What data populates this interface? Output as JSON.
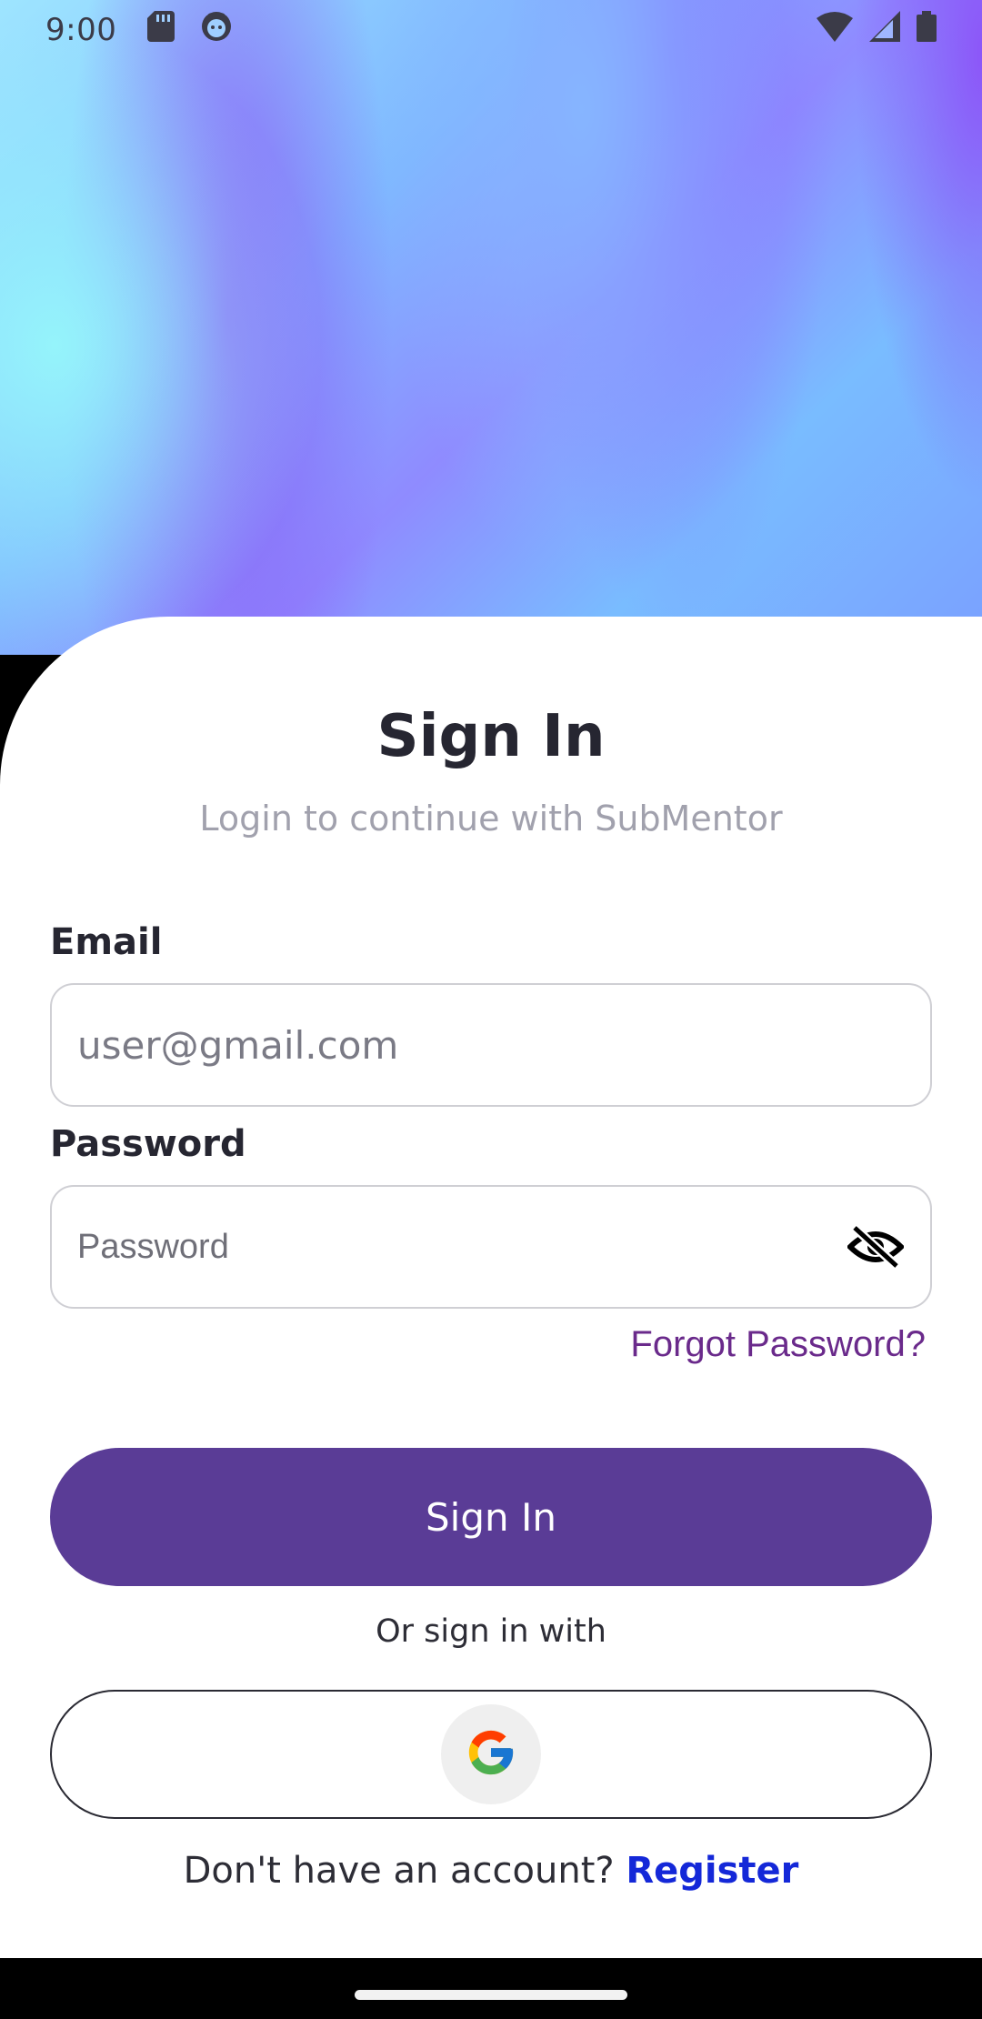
{
  "status_bar": {
    "time": "9:00",
    "icons_left": [
      "sd-card-icon",
      "android-debug-icon"
    ],
    "icons_right": [
      "wifi-icon",
      "signal-icon",
      "battery-icon"
    ]
  },
  "colors": {
    "primary_button": "#5a3c96",
    "forgot_link": "#6a2a8b",
    "register_link": "#1428d8",
    "title": "#262631",
    "subtitle": "#a1a1ad"
  },
  "header": {
    "title": "Sign In",
    "subtitle": "Login to continue with SubMentor"
  },
  "form": {
    "email_label": "Email",
    "email_value": "",
    "email_placeholder": "user@gmail.com",
    "password_label": "Password",
    "password_value": "",
    "password_placeholder": "Password",
    "password_visibility_icon": "eye-off-icon",
    "forgot_password": "Forgot Password?",
    "submit_label": "Sign In"
  },
  "social": {
    "or_text": "Or sign in with",
    "google_icon": "google-g-icon"
  },
  "footer": {
    "prompt": "Don't have an account? ",
    "register_link": "Register"
  }
}
